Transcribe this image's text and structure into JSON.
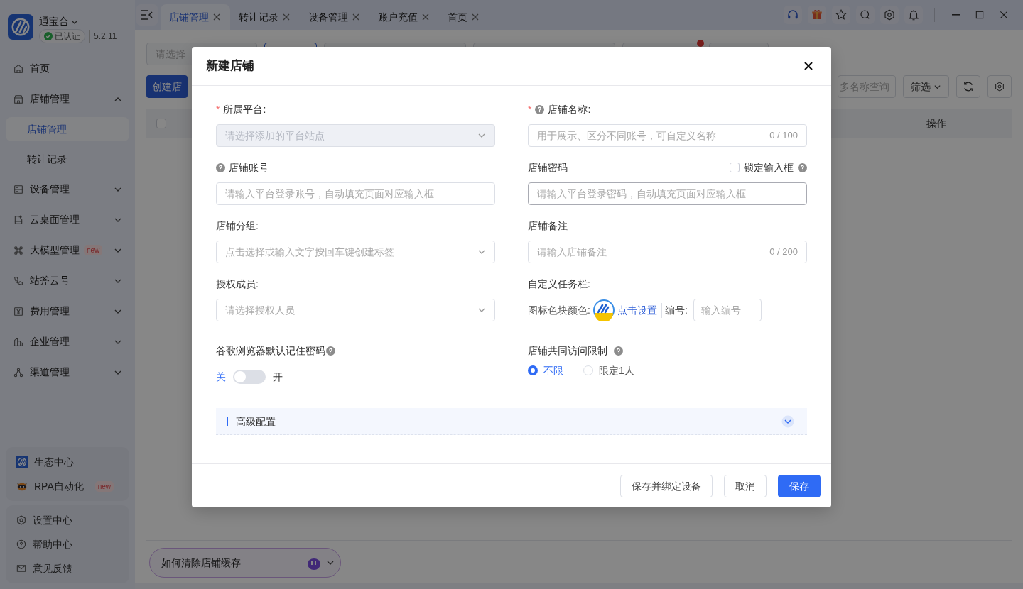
{
  "app": {
    "name": "通宝合",
    "verified": "已认证",
    "version": "5.2.11"
  },
  "sidebar": {
    "items": [
      {
        "label": "首页",
        "selected": false
      },
      {
        "label": "店铺管理",
        "selected": false,
        "expanded": true,
        "children": [
          {
            "label": "店铺管理",
            "selected": true
          },
          {
            "label": "转让记录",
            "selected": false
          }
        ]
      },
      {
        "label": "设备管理",
        "selected": false,
        "expanded": false
      },
      {
        "label": "云桌面管理",
        "selected": false,
        "expanded": false
      },
      {
        "label": "大模型管理",
        "selected": false,
        "expanded": false,
        "badge": "new"
      },
      {
        "label": "站斧云号",
        "selected": false,
        "expanded": false
      },
      {
        "label": "费用管理",
        "selected": false,
        "expanded": false
      },
      {
        "label": "企业管理",
        "selected": false,
        "expanded": false
      },
      {
        "label": "渠道管理",
        "selected": false,
        "expanded": false
      }
    ],
    "apps": [
      {
        "label": "生态中心"
      },
      {
        "label": "RPA自动化",
        "badge": "new"
      }
    ],
    "links": [
      {
        "label": "设置中心"
      },
      {
        "label": "帮助中心"
      },
      {
        "label": "意见反馈"
      }
    ]
  },
  "tabs": [
    {
      "label": "店铺管理",
      "selected": true
    },
    {
      "label": "转让记录",
      "selected": false
    },
    {
      "label": "设备管理",
      "selected": false
    },
    {
      "label": "账户充值",
      "selected": false
    },
    {
      "label": "首页",
      "selected": false
    }
  ],
  "page": {
    "group_placeholder": "请选择",
    "create_button": "创建店",
    "search_placeholder": "多名称查询",
    "filter_button": "筛选",
    "select_all_checked": false,
    "column_header": "操作"
  },
  "assistant": {
    "question": "如何清除店铺缓存"
  },
  "dialog": {
    "title": "新建店铺",
    "fields": [
      {
        "kind": "select",
        "required_mark": "*",
        "label": "所属平台:",
        "placeholder": "请选择添加的平台站点",
        "disabled": true
      },
      {
        "kind": "input",
        "required_mark": "*",
        "help": true,
        "label": "店铺名称:",
        "placeholder": "用于展示、区分不同账号，可自定义名称",
        "counter": "0 / 100"
      },
      {
        "kind": "input",
        "help": true,
        "label": "店铺账号",
        "placeholder": "请输入平台登录账号，自动填充页面对应输入框"
      },
      {
        "kind": "input",
        "label": "店铺密码",
        "placeholder": "请输入平台登录密码，自动填充页面对应输入框",
        "focused": true,
        "lock": {
          "label": "锁定输入框",
          "checked": false
        }
      },
      {
        "kind": "select",
        "label": "店铺分组:",
        "placeholder": "点击选择或输入文字按回车键创建标签"
      },
      {
        "kind": "input",
        "label": "店铺备注",
        "placeholder": "请输入店铺备注",
        "counter": "0 / 200"
      },
      {
        "kind": "select",
        "label": "授权成员:",
        "placeholder": "请选择授权人员"
      },
      {
        "kind": "taskbar",
        "label": "自定义任务栏:",
        "color_label": "图标色块颜色:",
        "link": "点击设置",
        "number_label": "编号:",
        "placeholder": "输入编号"
      },
      {
        "kind": "switch",
        "help": true,
        "label": "谷歌浏览器默认记住密码",
        "off_label": "关",
        "on_label": "开",
        "on": false
      },
      {
        "kind": "radio",
        "help": true,
        "label": "店铺共同访问限制",
        "options": [
          {
            "label": "不限",
            "selected": true
          },
          {
            "label": "限定1人",
            "selected": false
          }
        ]
      }
    ],
    "advanced": {
      "label": "高级配置",
      "expanded": false
    },
    "buttons": [
      {
        "label": "保存并绑定设备",
        "kind": "default"
      },
      {
        "label": "取消",
        "kind": "default"
      },
      {
        "label": "保存",
        "kind": "primary"
      }
    ]
  }
}
